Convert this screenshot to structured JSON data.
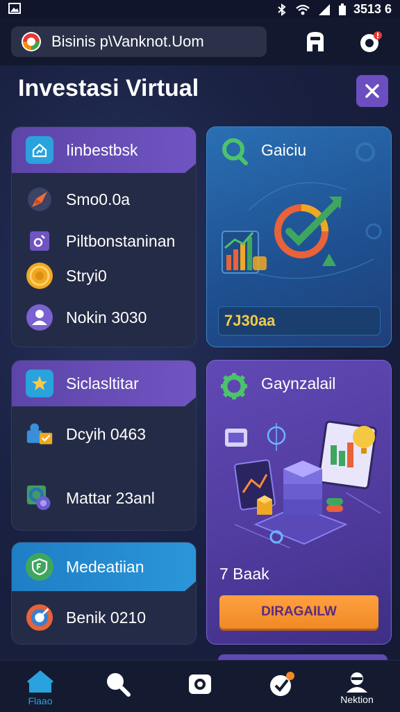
{
  "status_bar": {
    "time": "3513 6"
  },
  "browser": {
    "url": "Bisinis p\\Vanknot.Uom"
  },
  "page": {
    "title": "Investasi Virtual"
  },
  "left_cards": [
    {
      "title": "Iinbestbsk",
      "items": [
        {
          "label": "Smo0.0a",
          "icon": "rocket-icon"
        },
        {
          "label": "Piltbonstaninan",
          "icon": "chart-icon"
        },
        {
          "label": "Stryi0",
          "icon": "coin-icon"
        },
        {
          "label": "Nokin 3030",
          "icon": "user-icon"
        }
      ]
    },
    {
      "title": "Siclasltitar",
      "items": [
        {
          "label": "Dcyih 0463",
          "icon": "briefcase-icon"
        },
        {
          "label": "Mattar 23anl",
          "icon": "gear-icon"
        }
      ]
    },
    {
      "title": "Medeatiian",
      "items": [
        {
          "label": "Benik 0210",
          "icon": "target-icon"
        }
      ]
    }
  ],
  "right_cards": [
    {
      "title": "Gaiciu",
      "value": "7J30aa",
      "accent": "#f2c94c"
    },
    {
      "title": "Gaynzalail",
      "subtitle": "7 Baak",
      "button": "DIRAGAILW"
    }
  ],
  "bottom_nav": [
    {
      "label": "Flaao",
      "icon": "home-icon",
      "active": true
    },
    {
      "label": "",
      "icon": "search-icon"
    },
    {
      "label": "",
      "icon": "camera-icon"
    },
    {
      "label": "",
      "icon": "check-badge-icon"
    },
    {
      "label": "Nektion",
      "icon": "profile-icon"
    }
  ]
}
